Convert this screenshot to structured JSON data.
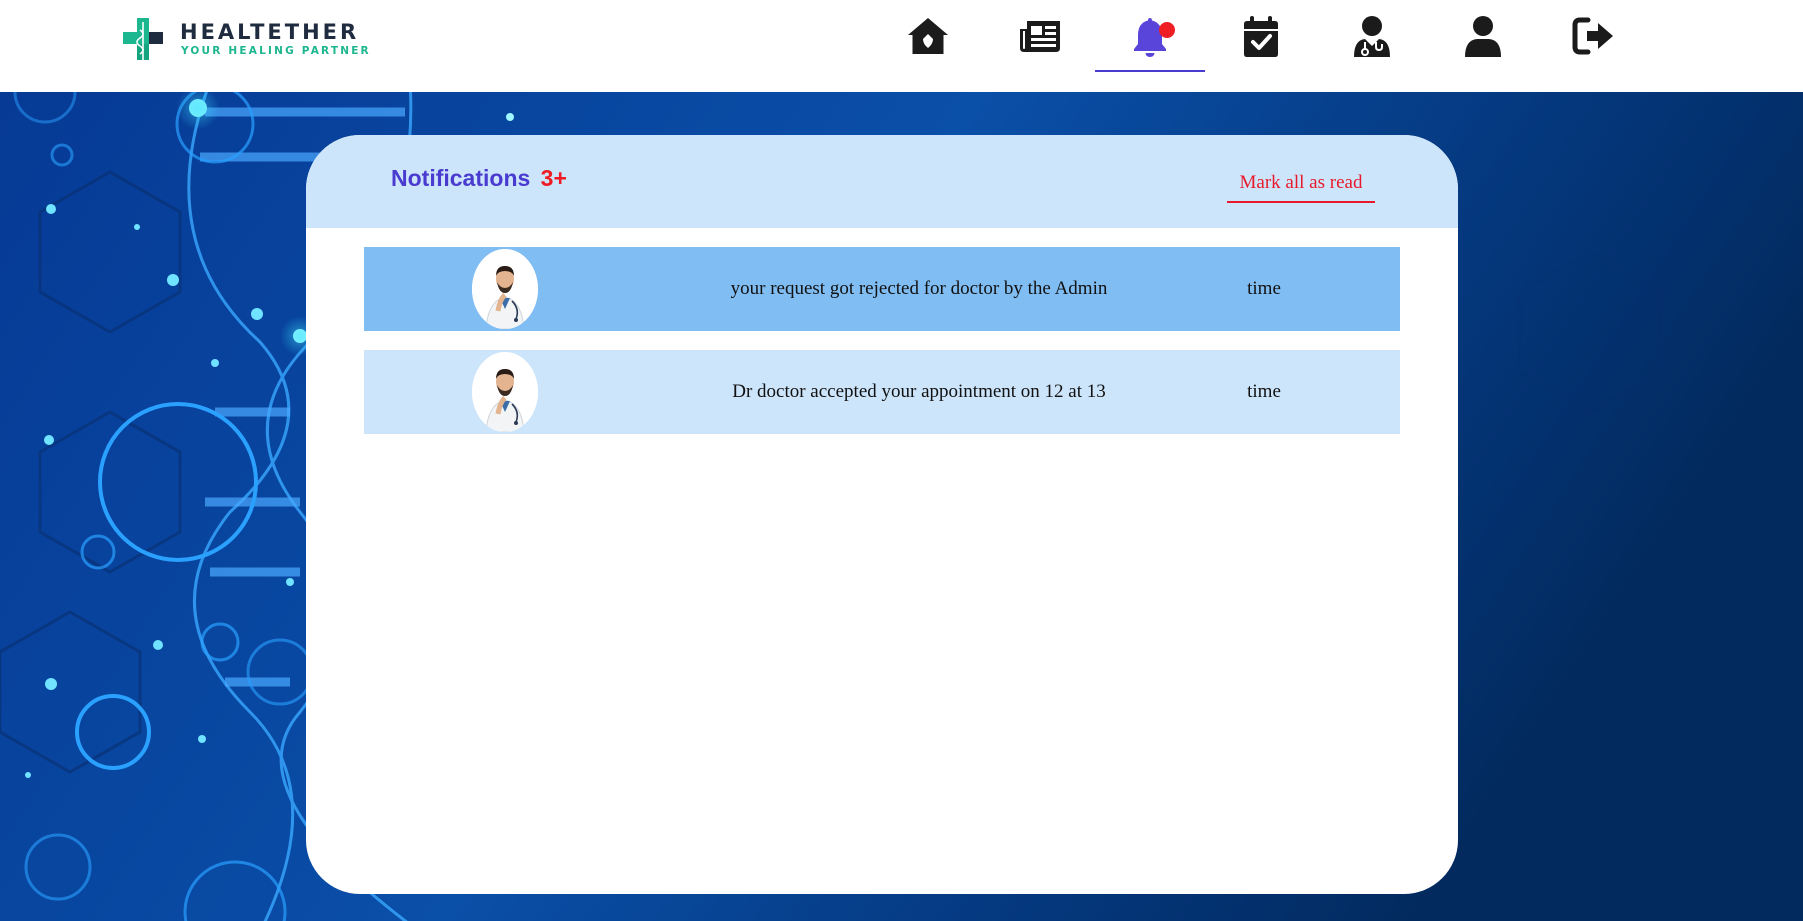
{
  "brand": {
    "name": "HEALTETHER",
    "tagline": "YOUR HEALING PARTNER"
  },
  "nav": [
    {
      "id": "home",
      "icon": "house-icon"
    },
    {
      "id": "news",
      "icon": "newspaper-icon"
    },
    {
      "id": "notifications",
      "icon": "bell-icon",
      "active": true,
      "has_indicator": true
    },
    {
      "id": "appointments",
      "icon": "calendar-check-icon"
    },
    {
      "id": "doctors",
      "icon": "user-doctor-icon"
    },
    {
      "id": "profile",
      "icon": "user-icon"
    },
    {
      "id": "logout",
      "icon": "sign-out-icon"
    }
  ],
  "notifications": {
    "title": "Notifications",
    "count": "3+",
    "mark_all_label": "Mark all as read",
    "items": [
      {
        "message": "your request got rejected for doctor by the Admin",
        "time": "time",
        "state": "unread"
      },
      {
        "message": "Dr doctor accepted your appointment on 12 at 13",
        "time": "time",
        "state": "read"
      }
    ]
  },
  "colors": {
    "accent": "#4a3bd0",
    "alert": "#ee1b24",
    "brand_green": "#1cb68f",
    "unread_row": "#80bdf2",
    "read_row": "#cde5fb"
  }
}
